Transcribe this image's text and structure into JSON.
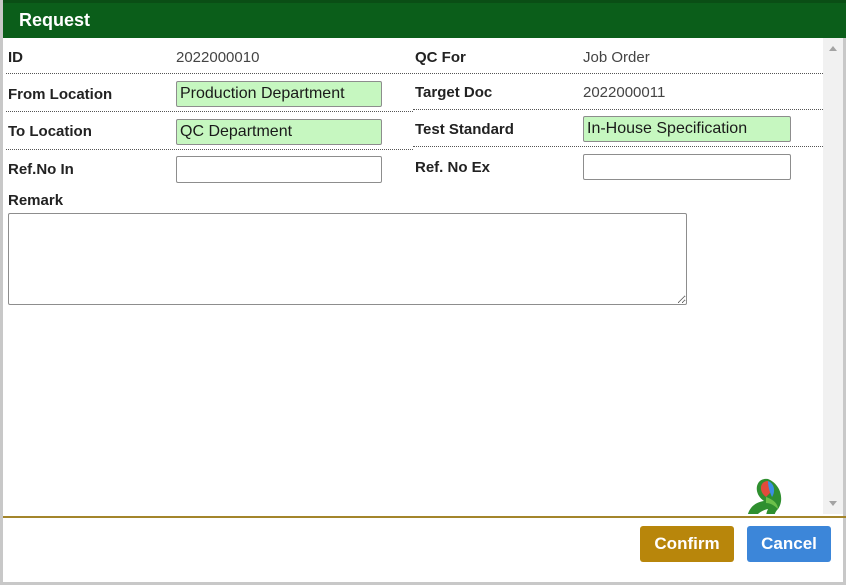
{
  "dialog": {
    "title": "Request"
  },
  "form": {
    "id_label": "ID",
    "id_value": "2022000010",
    "qc_for_label": "QC For",
    "qc_for_value": "Job Order",
    "from_location_label": "From Location",
    "from_location_value": "Production Department",
    "target_doc_label": "Target Doc",
    "target_doc_value": "2022000011",
    "to_location_label": "To Location",
    "to_location_value": "QC Department",
    "test_standard_label": "Test Standard",
    "test_standard_value": "In-House Specification",
    "ref_no_in_label": "Ref.No In",
    "ref_no_in_value": "",
    "ref_no_ex_label": "Ref. No Ex",
    "ref_no_ex_value": "",
    "remark_label": "Remark",
    "remark_value": ""
  },
  "footer": {
    "confirm_label": "Confirm",
    "cancel_label": "Cancel"
  },
  "colors": {
    "titlebar": "#0b5e1a",
    "filled_field": "#c6f7c0",
    "confirm": "#b8860b",
    "cancel": "#3c86d9"
  },
  "icons": {
    "logo": "company-logo-icon",
    "scroll_up": "scroll-up-arrow-icon",
    "scroll_down": "scroll-down-arrow-icon"
  }
}
